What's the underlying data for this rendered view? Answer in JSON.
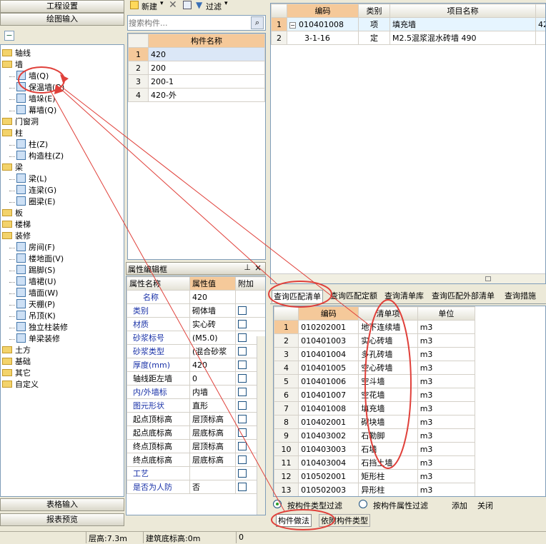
{
  "left": {
    "top_buttons": [
      "工程设置",
      "绘图输入"
    ],
    "bottom_buttons": [
      "表格输入",
      "报表预览"
    ],
    "tree": [
      {
        "label": "轴线",
        "type": "folder",
        "level": 0
      },
      {
        "label": "墙",
        "type": "folder",
        "level": 0
      },
      {
        "label": "墙(Q)",
        "type": "leaf",
        "level": 1
      },
      {
        "label": "保温墙(Q)",
        "type": "leaf",
        "level": 1
      },
      {
        "label": "墙垛(E)",
        "type": "leaf",
        "level": 1
      },
      {
        "label": "幕墙(Q)",
        "type": "leaf",
        "level": 1
      },
      {
        "label": "门窗洞",
        "type": "folder",
        "level": 0
      },
      {
        "label": "柱",
        "type": "folder",
        "level": 0
      },
      {
        "label": "柱(Z)",
        "type": "leaf",
        "level": 1
      },
      {
        "label": "构造柱(Z)",
        "type": "leaf",
        "level": 1
      },
      {
        "label": "梁",
        "type": "folder",
        "level": 0
      },
      {
        "label": "梁(L)",
        "type": "leaf",
        "level": 1
      },
      {
        "label": "连梁(G)",
        "type": "leaf",
        "level": 1
      },
      {
        "label": "圈梁(E)",
        "type": "leaf",
        "level": 1
      },
      {
        "label": "板",
        "type": "folder",
        "level": 0
      },
      {
        "label": "楼梯",
        "type": "folder",
        "level": 0
      },
      {
        "label": "装修",
        "type": "folder",
        "level": 0
      },
      {
        "label": "房间(F)",
        "type": "leaf",
        "level": 1
      },
      {
        "label": "楼地面(V)",
        "type": "leaf",
        "level": 1
      },
      {
        "label": "踢脚(S)",
        "type": "leaf",
        "level": 1
      },
      {
        "label": "墙裙(U)",
        "type": "leaf",
        "level": 1
      },
      {
        "label": "墙面(W)",
        "type": "leaf",
        "level": 1
      },
      {
        "label": "天棚(P)",
        "type": "leaf",
        "level": 1
      },
      {
        "label": "吊顶(K)",
        "type": "leaf",
        "level": 1
      },
      {
        "label": "独立柱装修",
        "type": "leaf",
        "level": 1
      },
      {
        "label": "单梁装修",
        "type": "leaf",
        "level": 1
      },
      {
        "label": "土方",
        "type": "folder",
        "level": 0
      },
      {
        "label": "基础",
        "type": "folder",
        "level": 0
      },
      {
        "label": "其它",
        "type": "folder",
        "level": 0
      },
      {
        "label": "自定义",
        "type": "folder",
        "level": 0
      }
    ]
  },
  "component_panel": {
    "toolbar": {
      "new": "新建",
      "filter": "过滤"
    },
    "search_placeholder": "搜索构件...",
    "header": "构件名称",
    "rows": [
      "420",
      "200",
      "200-1",
      "420-外"
    ]
  },
  "property_panel": {
    "title": "属性编辑框",
    "pin": "ᵖ",
    "close": "×",
    "headers": [
      "属性名称",
      "属性值",
      "附加"
    ],
    "rows": [
      {
        "name": "名称",
        "value": "420",
        "blue": true,
        "check": false
      },
      {
        "name": "类别",
        "value": "砌体墙",
        "blue": true,
        "check": true
      },
      {
        "name": "材质",
        "value": "实心砖",
        "blue": true,
        "check": true
      },
      {
        "name": "砂浆标号",
        "value": "(M5.0)",
        "blue": true,
        "check": true
      },
      {
        "name": "砂浆类型",
        "value": "(混合砂浆",
        "blue": true,
        "check": true
      },
      {
        "name": "厚度(mm)",
        "value": "420",
        "blue": true,
        "check": true
      },
      {
        "name": "轴线距左墙",
        "value": "0",
        "blue": false,
        "check": true
      },
      {
        "name": "内/外墙标",
        "value": "内墙",
        "blue": true,
        "check": true
      },
      {
        "name": "图元形状",
        "value": "直形",
        "blue": true,
        "check": true
      },
      {
        "name": "起点顶标高",
        "value": "层顶标高",
        "blue": false,
        "check": true
      },
      {
        "name": "起点底标高",
        "value": "层底标高",
        "blue": false,
        "check": true
      },
      {
        "name": "终点顶标高",
        "value": "层顶标高",
        "blue": false,
        "check": true
      },
      {
        "name": "终点底标高",
        "value": "层底标高",
        "blue": false,
        "check": true
      },
      {
        "name": "工艺",
        "value": "",
        "blue": true,
        "check": true
      },
      {
        "name": "是否为人防",
        "value": "否",
        "blue": true,
        "check": true
      }
    ]
  },
  "top_table": {
    "headers": [
      "编码",
      "类别",
      "项目名称"
    ],
    "rows": [
      {
        "num": "1",
        "code": "010401008",
        "type": "项",
        "name": "填充墙",
        "extra": "42"
      },
      {
        "num": "2",
        "code": "3-1-16",
        "type": "定",
        "name": "M2.5混浆混水砖墙 490",
        "extra": ""
      }
    ]
  },
  "query": {
    "tabs": [
      "查询匹配清单",
      "查询匹配定额",
      "查询清单库",
      "查询匹配外部清单",
      "查询措施"
    ],
    "headers": [
      "编码",
      "清单项",
      "单位"
    ],
    "rows": [
      {
        "num": "1",
        "code": "010202001",
        "name": "地下连续墙",
        "unit": "m3"
      },
      {
        "num": "2",
        "code": "010401003",
        "name": "实心砖墙",
        "unit": "m3"
      },
      {
        "num": "3",
        "code": "010401004",
        "name": "多孔砖墙",
        "unit": "m3"
      },
      {
        "num": "4",
        "code": "010401005",
        "name": "空心砖墙",
        "unit": "m3"
      },
      {
        "num": "5",
        "code": "010401006",
        "name": "空斗墙",
        "unit": "m3"
      },
      {
        "num": "6",
        "code": "010401007",
        "name": "空花墙",
        "unit": "m3"
      },
      {
        "num": "7",
        "code": "010401008",
        "name": "填充墙",
        "unit": "m3"
      },
      {
        "num": "8",
        "code": "010402001",
        "name": "砌块墙",
        "unit": "m3"
      },
      {
        "num": "9",
        "code": "010403002",
        "name": "石勒脚",
        "unit": "m3"
      },
      {
        "num": "10",
        "code": "010403003",
        "name": "石墙",
        "unit": "m3"
      },
      {
        "num": "11",
        "code": "010403004",
        "name": "石挡土墙",
        "unit": "m3"
      },
      {
        "num": "12",
        "code": "010502001",
        "name": "矩形柱",
        "unit": "m3"
      },
      {
        "num": "13",
        "code": "010502003",
        "name": "异形柱",
        "unit": "m3"
      }
    ],
    "filter_by_type": "按构件类型过滤",
    "filter_by_attr": "按构件属性过滤",
    "add": "添加",
    "close": "关闭",
    "bottom_tabs": [
      "构件做法",
      "依附构件类型"
    ]
  },
  "status": {
    "floor_height": "层高:7.3m",
    "bottom_elev": "建筑底标高:0m",
    "value": "0"
  }
}
